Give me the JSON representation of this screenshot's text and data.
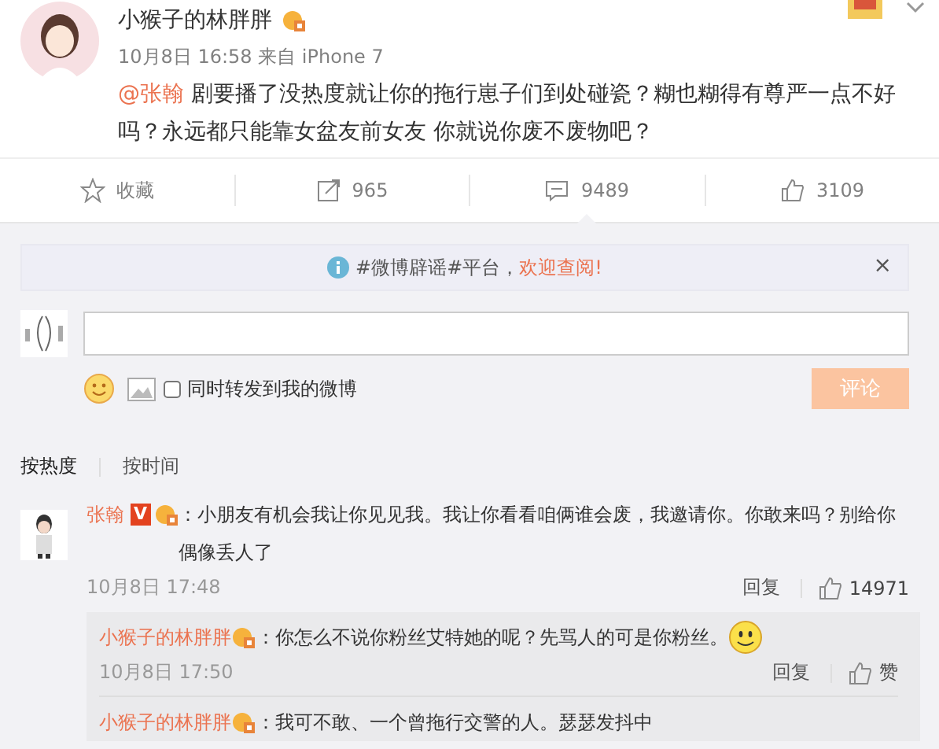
{
  "post": {
    "author": "小猴子的林胖胖",
    "time": "10月8日 16:58 来自 iPhone 7",
    "mention": "@张翰",
    "text": " 剧要播了没热度就让你的拖行崽子们到处碰瓷？糊也糊得有尊严一点不好吗？永远都只能靠女盆友前女友 你就说你废不废物吧？"
  },
  "actions": [
    {
      "kind": "favorite",
      "label": "收藏",
      "selected": false
    },
    {
      "kind": "repost",
      "label": "965",
      "selected": false
    },
    {
      "kind": "comment",
      "label": "9489",
      "selected": true
    },
    {
      "kind": "like",
      "label": "3109",
      "selected": false
    }
  ],
  "notice": {
    "text": "#微博辟谣#平台，",
    "link": "欢迎查阅!",
    "close": "×"
  },
  "composer": {
    "also_repost": {
      "label": "同时转发到我的微博",
      "checked": false
    },
    "button": {
      "label": "评论",
      "disabled": true
    }
  },
  "sort_tabs": [
    {
      "label": "按热度",
      "selected": true
    },
    {
      "label": "按时间",
      "selected": false
    }
  ],
  "comments": [
    {
      "author": "张翰",
      "verified": "V",
      "text": "：小朋友有机会我让你见见我。我让你看看咱俩谁会废，我邀请你。你敢来吗？别给你偶像丢人了",
      "time": "10月8日 17:48",
      "reply": "回复",
      "likes": "14971",
      "replies": [
        {
          "author": "小猴子的林胖胖",
          "text": "：你怎么不说你粉丝艾特她的呢？先骂人的可是你粉丝。",
          "emoji": true,
          "time": "10月8日 17:50",
          "reply": "回复",
          "like": "赞"
        },
        {
          "author": "小猴子的林胖胖",
          "text": "：我可不敢、一个曾拖行交警的人。瑟瑟发抖中",
          "emoji": false
        }
      ]
    }
  ]
}
